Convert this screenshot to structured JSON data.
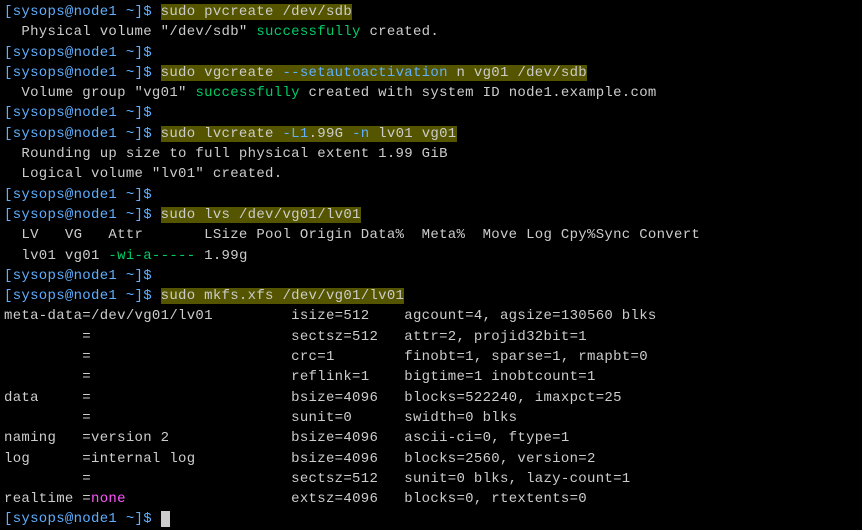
{
  "prompt": "[sysops@node1 ~]$ ",
  "cmd1": "sudo pvcreate /dev/sdb",
  "out1a": "  Physical volume \"/dev/sdb\" ",
  "out1b": "successfully",
  "out1c": " created.",
  "cmd2a": "sudo vgcreate ",
  "cmd2b": "--setautoactivation",
  "cmd2c": " n vg01 /dev/sdb",
  "out2a": "  Volume group \"vg01\" ",
  "out2b": "successfully",
  "out2c": " created with system ID node1.example.com",
  "cmd3a": "sudo lvcreate ",
  "cmd3b": "-L1",
  "cmd3c": ".99G ",
  "cmd3d": "-n",
  "cmd3e": " lv01 vg01",
  "out3a": "  Rounding up size to full physical extent 1.99 GiB",
  "out3b": "  Logical volume \"lv01\" created.",
  "cmd4": "sudo lvs /dev/vg01/lv01",
  "out4a": "  LV   VG   Attr       LSize Pool Origin Data%  Meta%  Move Log Cpy%Sync Convert",
  "out4b": "  lv01 vg01 ",
  "out4attr": "-wi-a-----",
  "out4c": " 1.99g",
  "cmd5": "sudo mkfs.xfs /dev/vg01/lv01",
  "mkfs": [
    "meta-data=/dev/vg01/lv01         isize=512    agcount=4, agsize=130560 blks",
    "         =                       sectsz=512   attr=2, projid32bit=1",
    "         =                       crc=1        finobt=1, sparse=1, rmapbt=0",
    "         =                       reflink=1    bigtime=1 inobtcount=1",
    "data     =                       bsize=4096   blocks=522240, imaxpct=25",
    "         =                       sunit=0      swidth=0 blks",
    "naming   =version 2              bsize=4096   ascii-ci=0, ftype=1",
    "log      =internal log           bsize=4096   blocks=2560, version=2",
    "         =                       sectsz=512   sunit=0 blks, lazy-count=1"
  ],
  "rt_a": "realtime =",
  "rt_b": "none",
  "rt_c": "                   extsz=4096   blocks=0, rtextents=0"
}
